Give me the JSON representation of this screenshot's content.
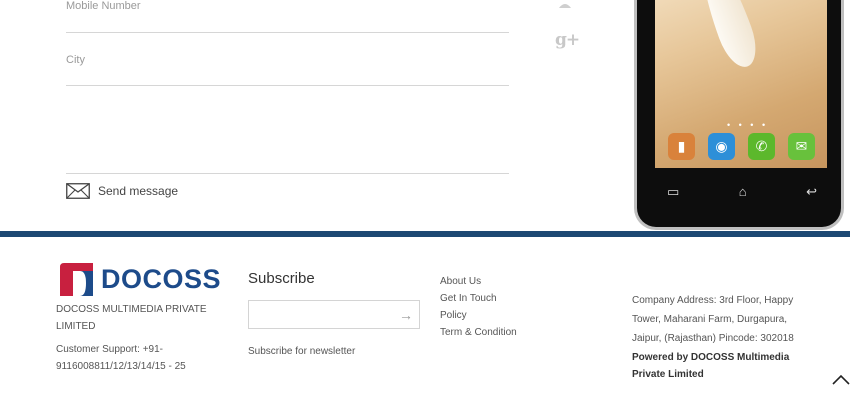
{
  "form": {
    "mobile_placeholder": "Mobile Number",
    "city_placeholder": "City",
    "message_placeholder": "",
    "send_label": "Send message"
  },
  "social": {
    "icons": [
      "person-icon",
      "google-plus-icon"
    ],
    "gplus_glyph": "g+"
  },
  "phone": {
    "nav_glyphs": [
      "▭",
      "⌂",
      "↩"
    ],
    "page_dots": "• • • •"
  },
  "footer": {
    "logo_text": "DOCOSS",
    "brand_colors": {
      "logo_blue": "#1d4b8a",
      "logo_red": "#c8203f",
      "footer_bar": "#1d4873"
    },
    "company_name": "DOCOSS MULTIMEDIA PRIVATE LIMITED",
    "support": "Customer Support: +91-9116008811/12/13/14/15 - 25",
    "subscribe": {
      "title": "Subscribe",
      "input_placeholder": "",
      "submit_glyph": "→",
      "note": "Subscribe for newsletter"
    },
    "links": [
      "About Us",
      "Get In Touch",
      "Policy",
      "Term & Condition"
    ],
    "address": "Company Address: 3rd Floor, Happy Tower, Maharani Farm, Durgapura, Jaipur, (Rajasthan) Pincode: 302018",
    "powered_by": "Powered by DOCOSS Multimedia Private Limited"
  }
}
